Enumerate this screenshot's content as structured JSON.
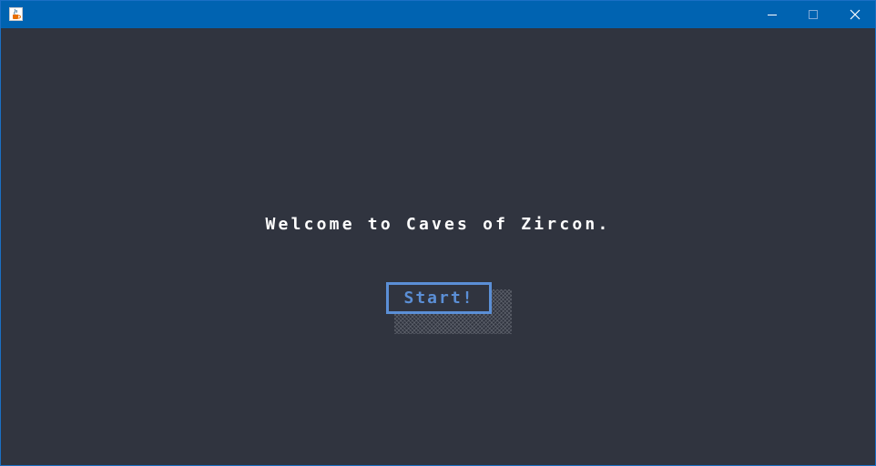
{
  "window": {
    "title": "",
    "controls": {
      "minimize": "minimize-icon",
      "maximize": "maximize-icon",
      "close": "close-icon"
    },
    "app_icon": "java-cup-icon"
  },
  "main": {
    "welcome_text": "Welcome to Caves of Zircon.",
    "start_label": "Start!"
  },
  "colors": {
    "titlebar": "#0063b1",
    "background": "#30343f",
    "text": "#ffffff",
    "accent": "#5b8fd6"
  }
}
